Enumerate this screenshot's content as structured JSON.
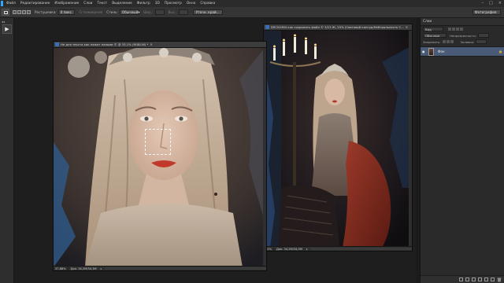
{
  "menubar": {
    "items": [
      "Файл",
      "Редактирование",
      "Изображение",
      "Слои",
      "Текст",
      "Выделение",
      "Фильтр",
      "3D",
      "Просмотр",
      "Окно",
      "Справка"
    ],
    "window_controls": [
      "–",
      "□",
      "×"
    ]
  },
  "options_bar": {
    "feather_label": "Растушевка:",
    "feather_value": "0 пикс.",
    "antialias_label": "Сглаживание",
    "style_label": "Стиль:",
    "style_value": "Обычный",
    "width_label": "Шир.:",
    "height_label": "Выс.:",
    "refine_button": "Уточн. край...",
    "workspace": "Фотография"
  },
  "toolbar": {
    "collapse_glyph": "◂◂",
    "active_tool_glyph": "▶"
  },
  "doc1": {
    "title": "Не для текста как нажат пальми © @ 33,1% (RGB/16) *",
    "close_glyph": "×",
    "zoom": "37,88%",
    "size": "Док: 34,2M/34,3M",
    "arrow": "▸"
  },
  "doc2": {
    "title": "DSC04364 как сохранить файл © 3/13 Ж, 25% (Световой контур/Нейтральность С...",
    "close_glyph": "×",
    "zoom": "25%",
    "size": "Док: 34,2M/34,0M",
    "arrow": "▸"
  },
  "layers_panel": {
    "header": "Слои",
    "kind_filter": "Вид",
    "blend_mode": "Обычные",
    "opacity_label": "Непрозрачность:",
    "lock_label": "Закрепить:",
    "fill_label": "Заливка:",
    "layer_name": "Фон",
    "eye_glyph": "●",
    "lock_glyph": "🔒"
  },
  "colors": {
    "accent_selected_layer": "#4a5b78",
    "app_bg": "#1e1e1e",
    "ps_blue": "#3b6fb5"
  }
}
